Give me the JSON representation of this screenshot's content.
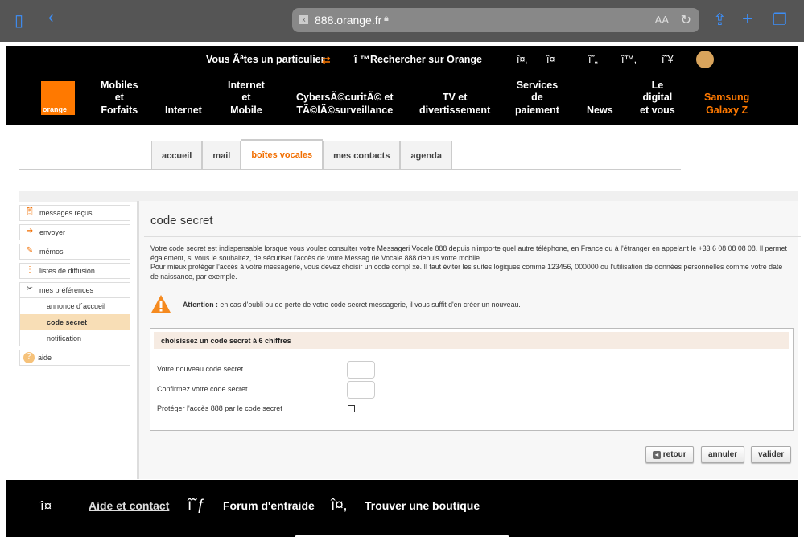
{
  "browser": {
    "url": "888.orange.fr"
  },
  "header": {
    "logo": "orange",
    "particulier": "Vous Ãªtes un particulier",
    "search": "Rechercher sur Orange",
    "search_prefix": "î ™",
    "icon_text_1": "î¤‚",
    "icon_text_2": "î¤",
    "icon_text_3": "î˜„",
    "icon_text_4": "î™‚",
    "icon_text_5": "î˜¥",
    "nav": [
      {
        "label": "Mobiles\net\nForfaits"
      },
      {
        "label": "Internet"
      },
      {
        "label": "Internet\net\nMobile"
      },
      {
        "label": "CybersÃ©curitÃ© et\nTÃ©lÃ©surveillance"
      },
      {
        "label": "TV et\ndivertissement"
      },
      {
        "label": "Services\nde\npaiement"
      },
      {
        "label": "News"
      },
      {
        "label": "Le\ndigital\net vous"
      },
      {
        "label": "Samsung\nGalaxy Z"
      }
    ]
  },
  "tabs": [
    {
      "label": "accueil"
    },
    {
      "label": "mail"
    },
    {
      "label": "boîtes vocales"
    },
    {
      "label": "mes contacts"
    },
    {
      "label": "agenda"
    }
  ],
  "sidebar": {
    "items": [
      {
        "label": "messages reçus"
      },
      {
        "label": "envoyer"
      },
      {
        "label": "mémos"
      },
      {
        "label": "listes de diffusion"
      },
      {
        "label": "mes préférences"
      },
      {
        "label": "aide"
      }
    ],
    "subitems": [
      {
        "label": "annonce d´accueil"
      },
      {
        "label": "code secret"
      },
      {
        "label": "notification"
      }
    ]
  },
  "content": {
    "title": "code secret",
    "para1": "Votre code secret est indispensable lorsque vous voulez consulter votre Messageri  Vocale 888 depuis n'importe quel autre téléphone, en France ou à l'étranger en appelant le +33 6 08 08 08 08. Il permet également, si vous le souhaitez, de sécuriser l'accès de votre Messag rie Vocale 888 depuis votre mobile.",
    "para2": "Pour mieux protéger l'accès à votre messagerie, vous devez choisir un code compl xe. Il faut éviter les suites logiques comme 123456, 000000 ou l'utilisation de données personnelles comme votre date de naissance, par exemple.",
    "warning_label": "Attention :",
    "warning_text": " en cas d'oubli ou de perte de votre code secret messagerie, il vous suffit d'en créer un nouveau.",
    "form": {
      "heading": "choisissez un code secret à 6 chiffres",
      "new_label": "Votre nouveau code secret",
      "new_value": "",
      "confirm_label": "Confirmez votre code secret",
      "confirm_value": "",
      "protect_label": "Protéger l'accès 888 par le code secret",
      "protect_checked": false
    },
    "buttons": {
      "back": "retour",
      "cancel": "annuler",
      "submit": "valider"
    }
  },
  "footer": {
    "icon1": "î¤",
    "help": "Aide et contact",
    "icon2": "î˜ƒ",
    "forum": "Forum d'entraide",
    "icon3": "î¤‚",
    "shop": "Trouver une boutique"
  },
  "colors": {
    "orange": "#ff7900",
    "accent": "#f16e00",
    "highlight": "#f8deb6"
  }
}
